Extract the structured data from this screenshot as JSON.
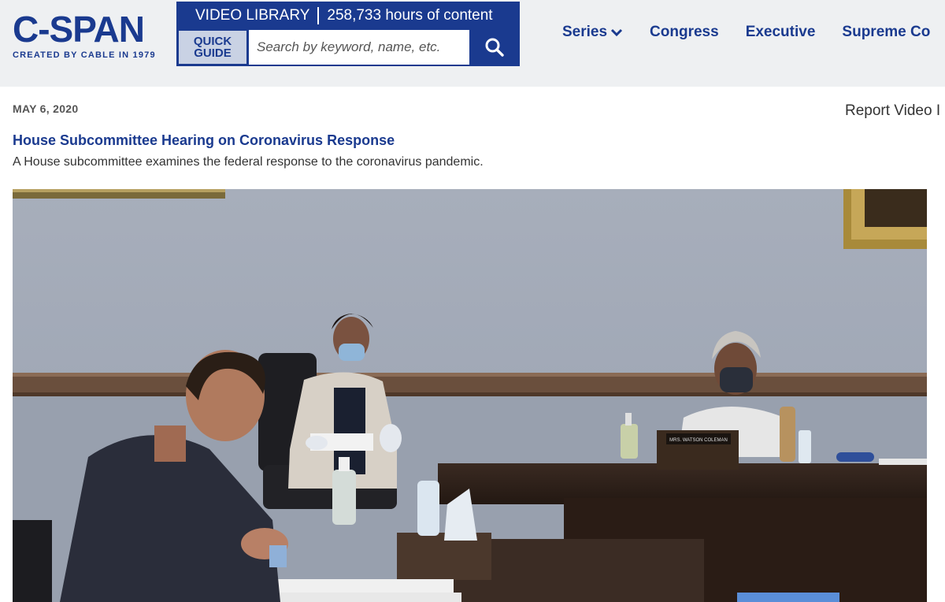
{
  "logo": {
    "name": "C-SPAN",
    "tagline": "CREATED BY CABLE IN 1979"
  },
  "video_library": {
    "label": "VIDEO LIBRARY",
    "hours": "258,733 hours of content",
    "quick_guide_line1": "QUICK",
    "quick_guide_line2": "GUIDE",
    "search_placeholder": "Search by keyword, name, etc.",
    "search_icon": "search-icon"
  },
  "nav": {
    "series": "Series",
    "series_icon": "chevron-down-icon",
    "congress": "Congress",
    "executive": "Executive",
    "supreme": "Supreme Co"
  },
  "program": {
    "date": "MAY 6, 2020",
    "report": "Report Video I",
    "title": "House Subcommittee Hearing on Coronavirus Response",
    "description": "A House subcommittee examines the federal response to the coronavirus pandemic.",
    "nameplate": "MRS. WATSON COLEMAN"
  },
  "colors": {
    "brand": "#1a3a8f",
    "header_bg": "#eef0f2"
  }
}
